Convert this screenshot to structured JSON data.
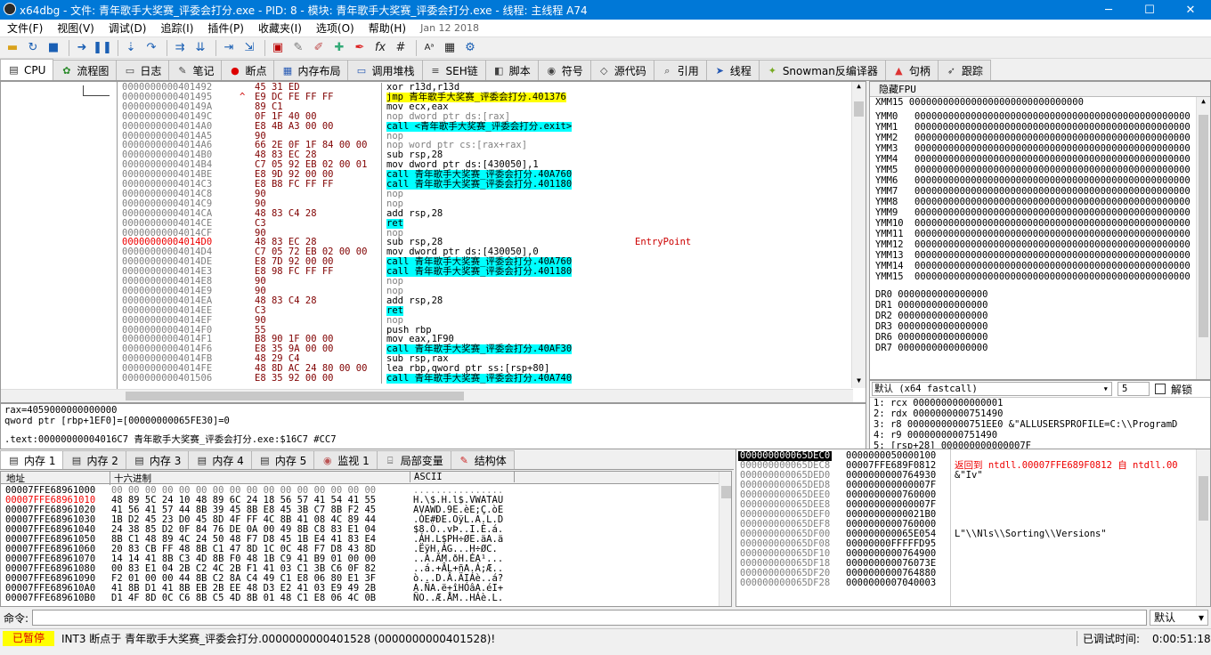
{
  "window": {
    "title": "x64dbg - 文件: 青年歌手大奖赛_评委会打分.exe - PID: 8 - 模块: 青年歌手大奖赛_评委会打分.exe - 线程: 主线程 A74",
    "minimize": "─",
    "maximize": "☐",
    "close": "✕"
  },
  "menu": [
    "文件(F)",
    "视图(V)",
    "调试(D)",
    "追踪(I)",
    "插件(P)",
    "收藏夹(I)",
    "选项(O)",
    "帮助(H)",
    "Jan 12 2018"
  ],
  "toolbar": {
    "fx": "fx",
    "hash": "#"
  },
  "tabs": [
    "CPU",
    "流程图",
    "日志",
    "笔记",
    "断点",
    "内存布局",
    "调用堆栈",
    "SEH链",
    "脚本",
    "符号",
    "源代码",
    "引用",
    "线程",
    "Snowman反编译器",
    "句柄",
    "跟踪"
  ],
  "disasm": [
    {
      "addr": "0000000000401492",
      "bytes": "45 31 ED",
      "ins": "xor r13d,r13d",
      "hl": "",
      "cmt": ""
    },
    {
      "addr": "0000000000401495",
      "bytes": "E9 DC FE FF FF",
      "ins": "jmp 青年歌手大奖赛_评委会打分.401376",
      "hl": "y",
      "cmt": "",
      "arrow": "^"
    },
    {
      "addr": "000000000040149A",
      "bytes": "89 C1",
      "ins": "mov ecx,eax",
      "hl": "",
      "cmt": ""
    },
    {
      "addr": "000000000040149C",
      "bytes": "0F 1F 40 00",
      "ins": "nop dword ptr ds:[rax]",
      "hl": "",
      "cmt": "",
      "dim": true
    },
    {
      "addr": "00000000004014A0",
      "bytes": "E8 4B A3 00 00",
      "ins": "call <青年歌手大奖赛_评委会打分.exit>",
      "hl": "c",
      "cmt": ""
    },
    {
      "addr": "00000000004014A5",
      "bytes": "90",
      "ins": "nop",
      "hl": "",
      "cmt": "",
      "dim": true
    },
    {
      "addr": "00000000004014A6",
      "bytes": "66 2E 0F 1F 84 00 00",
      "ins": "nop word ptr cs:[rax+rax]",
      "hl": "",
      "cmt": "",
      "dim": true
    },
    {
      "addr": "00000000004014B0",
      "bytes": "48 83 EC 28",
      "ins": "sub rsp,28",
      "hl": "",
      "cmt": ""
    },
    {
      "addr": "00000000004014B4",
      "bytes": "C7 05 92 EB 02 00 01",
      "ins": "mov dword ptr ds:[430050],1",
      "hl": "",
      "cmt": ""
    },
    {
      "addr": "00000000004014BE",
      "bytes": "E8 9D 92 00 00",
      "ins": "call 青年歌手大奖赛_评委会打分.40A760",
      "hl": "c",
      "cmt": ""
    },
    {
      "addr": "00000000004014C3",
      "bytes": "E8 B8 FC FF FF",
      "ins": "call 青年歌手大奖赛_评委会打分.401180",
      "hl": "c",
      "cmt": ""
    },
    {
      "addr": "00000000004014C8",
      "bytes": "90",
      "ins": "nop",
      "hl": "",
      "cmt": "",
      "dim": true
    },
    {
      "addr": "00000000004014C9",
      "bytes": "90",
      "ins": "nop",
      "hl": "",
      "cmt": "",
      "dim": true
    },
    {
      "addr": "00000000004014CA",
      "bytes": "48 83 C4 28",
      "ins": "add rsp,28",
      "hl": "",
      "cmt": ""
    },
    {
      "addr": "00000000004014CE",
      "bytes": "C3",
      "ins": "ret",
      "hl": "c",
      "cmt": ""
    },
    {
      "addr": "00000000004014CF",
      "bytes": "90",
      "ins": "nop",
      "hl": "",
      "cmt": "",
      "dim": true
    },
    {
      "addr": "00000000004014D0",
      "bytes": "48 83 EC 28",
      "ins": "sub rsp,28",
      "hl": "",
      "cmt": "EntryPoint",
      "red": true
    },
    {
      "addr": "00000000004014D4",
      "bytes": "C7 05 72 EB 02 00 00",
      "ins": "mov dword ptr ds:[430050],0",
      "hl": "",
      "cmt": ""
    },
    {
      "addr": "00000000004014DE",
      "bytes": "E8 7D 92 00 00",
      "ins": "call 青年歌手大奖赛_评委会打分.40A760",
      "hl": "c",
      "cmt": ""
    },
    {
      "addr": "00000000004014E3",
      "bytes": "E8 98 FC FF FF",
      "ins": "call 青年歌手大奖赛_评委会打分.401180",
      "hl": "c",
      "cmt": ""
    },
    {
      "addr": "00000000004014E8",
      "bytes": "90",
      "ins": "nop",
      "hl": "",
      "cmt": "",
      "dim": true
    },
    {
      "addr": "00000000004014E9",
      "bytes": "90",
      "ins": "nop",
      "hl": "",
      "cmt": "",
      "dim": true
    },
    {
      "addr": "00000000004014EA",
      "bytes": "48 83 C4 28",
      "ins": "add rsp,28",
      "hl": "",
      "cmt": ""
    },
    {
      "addr": "00000000004014EE",
      "bytes": "C3",
      "ins": "ret",
      "hl": "c",
      "cmt": ""
    },
    {
      "addr": "00000000004014EF",
      "bytes": "90",
      "ins": "nop",
      "hl": "",
      "cmt": "",
      "dim": true
    },
    {
      "addr": "00000000004014F0",
      "bytes": "55",
      "ins": "push rbp",
      "hl": "",
      "cmt": ""
    },
    {
      "addr": "00000000004014F1",
      "bytes": "B8 90 1F 00 00",
      "ins": "mov eax,1F90",
      "hl": "",
      "cmt": ""
    },
    {
      "addr": "00000000004014F6",
      "bytes": "E8 35 9A 00 00",
      "ins": "call 青年歌手大奖赛_评委会打分.40AF30",
      "hl": "c",
      "cmt": ""
    },
    {
      "addr": "00000000004014FB",
      "bytes": "48 29 C4",
      "ins": "sub rsp,rax",
      "hl": "",
      "cmt": ""
    },
    {
      "addr": "00000000004014FE",
      "bytes": "48 8D AC 24 80 00 00",
      "ins": "lea rbp,qword ptr ss:[rsp+80]",
      "hl": "",
      "cmt": ""
    },
    {
      "addr": "0000000000401506",
      "bytes": "E8 35 92 00 00",
      "ins": "call 青年歌手大奖赛_评委会打分.40A740",
      "hl": "c",
      "cmt": ""
    }
  ],
  "regs": {
    "header": "隐藏FPU",
    "top": "XMM15  0000000000000000000000000000000",
    "ymm": [
      "YMM0",
      "YMM1",
      "YMM2",
      "YMM3",
      "YMM4",
      "YMM5",
      "YMM6",
      "YMM7",
      "YMM8",
      "YMM9",
      "YMM10",
      "YMM11",
      "YMM12",
      "YMM13",
      "YMM14",
      "YMM15"
    ],
    "ymmval": "0000000000000000000000000000000000000000000000000",
    "dr": [
      "DR0 0000000000000000",
      "DR1 0000000000000000",
      "DR2 0000000000000000",
      "DR3 0000000000000000",
      "DR6 0000000000000000",
      "DR7 0000000000000000"
    ]
  },
  "callconv": {
    "select": "默认 (x64 fastcall)",
    "count": "5",
    "unlock": "解锁",
    "args": [
      "1: rcx 0000000000000001",
      "2: rdx 0000000000751490",
      "3: r8 00000000000751EE0 &\"ALLUSERSPROFILE=C:\\\\ProgramD",
      "4: r9 0000000000751490",
      "5: [rsp+28] 000000000000007F"
    ]
  },
  "info": {
    "l1": "rax=4059000000000000",
    "l2": "qword ptr [rbp+1EF0]=[00000000065FE30]=0",
    "l3": ".text:00000000004016C7 青年歌手大奖赛_评委会打分.exe:$16C7 #CC7"
  },
  "dumptabs": [
    "内存 1",
    "内存 2",
    "内存 3",
    "内存 4",
    "内存 5",
    "监视 1",
    "局部变量",
    "结构体"
  ],
  "dumphdr": {
    "addr": "地址",
    "hex": "十六进制",
    "ascii": "ASCII"
  },
  "dump": [
    {
      "a": "00007FFE68961000",
      "h": "00 00 00 00 00 00 00 00  00 00 00 00 00 00 00 00",
      "s": "................"
    },
    {
      "a": "00007FFE68961010",
      "h": "48 89 5C 24 10 48 89 6C  24 18 56 57 41 54 41 55",
      "s": "H.\\$.H.l$.VWATAU",
      "red": true
    },
    {
      "a": "00007FFE68961020",
      "h": "41 56 41 57 44 8B 39 45  8B E8 45 3B C7 8B F2 45",
      "s": "AVAWD.9E.èE;Ç.òE"
    },
    {
      "a": "00007FFE68961030",
      "h": "1B D2 45 23 D0 45 8D 4F  FF 4C 8B 41 08 4C 89 44",
      "s": ".ÒE#ÐE.OÿL.A.L.D"
    },
    {
      "a": "00007FFE68961040",
      "h": "24 38 85 D2 0F 84 76 DE  0A 00 49 8B C8 83 E1 04",
      "s": "$8.Ò..vÞ..I.È.á."
    },
    {
      "a": "00007FFE68961050",
      "h": "8B C1 48 89 4C 24 50 48  F7 D8 45 1B E4 41 83 E4",
      "s": ".ÁH.L$PH÷ØE.äA.ä"
    },
    {
      "a": "00007FFE68961060",
      "h": "20 83 CB FF 48 8B C1 47  8D 1C 0C 48 F7 D8 43 8D",
      "s": " .ËÿH.ÁG...H÷ØC."
    },
    {
      "a": "00007FFE68961070",
      "h": "14 14 41 8B C3 4D 8B F0  48 1B C9 41 B9 01 00 00",
      "s": "..A.ÃM.ðH.ÉA¹..."
    },
    {
      "a": "00007FFE68961080",
      "h": "00 83 E1 04 2B C2 4C 2B  F1 41 03 C1 3B C6 0F 82",
      "s": "..á.+ÂL+ñA.Á;Æ.."
    },
    {
      "a": "00007FFE68961090",
      "h": "F2 01 00 00 44 8B C2 8A  C4 49 C1 E8 06 80 E1 3F",
      "s": "ò...D.Â.ÄIÁè..á?"
    },
    {
      "a": "00007FFE689610A0",
      "h": "41 8B D1 41 8B EB 2B EE  48 D3 E2 41 03 E9 49 2B",
      "s": "A.ÑA.ë+îHÓâA.éI+"
    },
    {
      "a": "00007FFE689610B0",
      "h": "D1 4F 8D 0C C6 8B C5 4D  8B 01 48 C1 E8 06 4C 0B",
      "s": "ÑO..Æ.ÅM..HÁè.L."
    }
  ],
  "stack": [
    {
      "a": "000000000065DEC0",
      "v": "0000000050000100",
      "c": "",
      "sel": true
    },
    {
      "a": "000000000065DEC8",
      "v": "00007FFE689F0812",
      "c": "返回到 ntdll.00007FFE689F0812 自 ntdll.00",
      "red": true
    },
    {
      "a": "000000000065DED0",
      "v": "0000000000764930",
      "c": "&\"Iv\""
    },
    {
      "a": "000000000065DED8",
      "v": "000000000000007F",
      "c": ""
    },
    {
      "a": "000000000065DEE0",
      "v": "0000000000760000",
      "c": ""
    },
    {
      "a": "000000000065DEE8",
      "v": "000000000000007F",
      "c": ""
    },
    {
      "a": "000000000065DEF0",
      "v": "00000000000021B0",
      "c": ""
    },
    {
      "a": "000000000065DEF8",
      "v": "0000000000760000",
      "c": ""
    },
    {
      "a": "000000000065DF00",
      "v": "000000000065E054",
      "c": "L\"\\\\Nls\\\\Sorting\\\\Versions\""
    },
    {
      "a": "000000000065DF08",
      "v": "00000000FFFFFD95",
      "c": ""
    },
    {
      "a": "000000000065DF10",
      "v": "0000000000764900",
      "c": ""
    },
    {
      "a": "000000000065DF18",
      "v": "000000000076073E",
      "c": ""
    },
    {
      "a": "000000000065DF20",
      "v": "0000000000764880",
      "c": ""
    },
    {
      "a": "000000000065DF28",
      "v": "0000000007040003",
      "c": ""
    }
  ],
  "cmd": {
    "label": "命令:",
    "mode": "默认"
  },
  "status": {
    "state": "已暂停",
    "msg": "INT3 断点于 青年歌手大奖赛_评委会打分.0000000000401528 (0000000000401528)!",
    "timelabel": "已调试时间:",
    "time": "0:00:51:18"
  }
}
